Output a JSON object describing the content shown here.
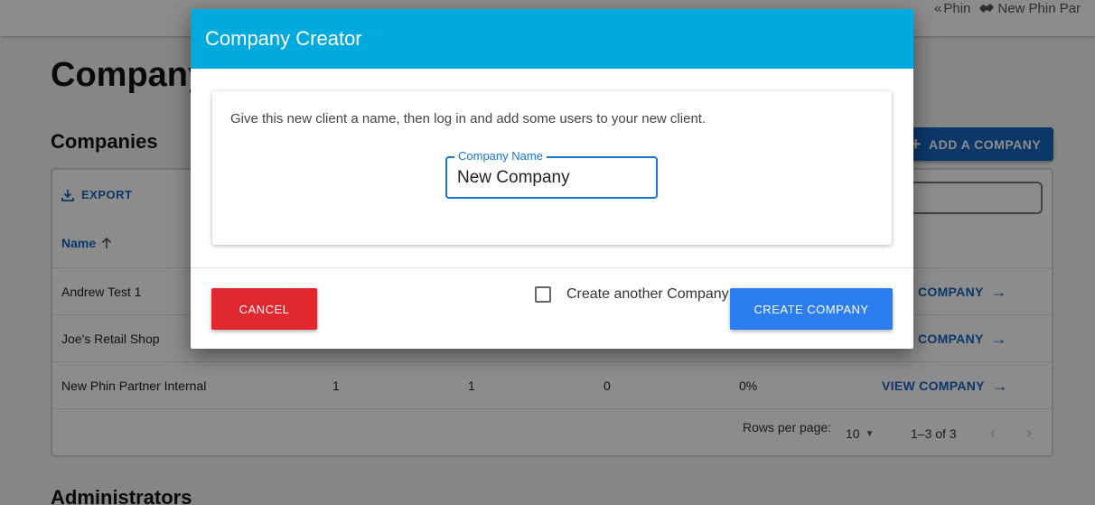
{
  "topbar": {
    "back_label": "Phin",
    "partner_label": "New Phin Par"
  },
  "page": {
    "title": "Company",
    "companies_heading": "Companies",
    "add_company_label": "ADD A COMPANY",
    "administrators_heading": "Administrators"
  },
  "table": {
    "export_label": "EXPORT",
    "name_header": "Name",
    "rows": [
      {
        "name": "Andrew Test 1",
        "c1": "",
        "c2": "",
        "c3": "",
        "c4": "",
        "view": "COMPANY"
      },
      {
        "name": "Joe's Retail Shop",
        "c1": "",
        "c2": "",
        "c3": "",
        "c4": "",
        "view": "COMPANY"
      },
      {
        "name": "New Phin Partner Internal",
        "c1": "1",
        "c2": "1",
        "c3": "0",
        "c4": "0%",
        "view": "VIEW COMPANY"
      }
    ],
    "footer": {
      "rows_per_page_label": "Rows per page:",
      "rows_per_page_value": "10",
      "range": "1–3 of 3"
    }
  },
  "dialog": {
    "title": "Company Creator",
    "description": "Give this new client a name, then log in and add some users to your new client.",
    "field_label": "Company Name",
    "field_value": "New Company",
    "cancel_label": "CANCEL",
    "create_another_label": "Create another Company",
    "create_label": "CREATE COMPANY"
  },
  "colors": {
    "dialog_header": "#00aadd",
    "primary": "#1565c0",
    "cancel": "#e0282e",
    "create": "#2b7df0"
  }
}
